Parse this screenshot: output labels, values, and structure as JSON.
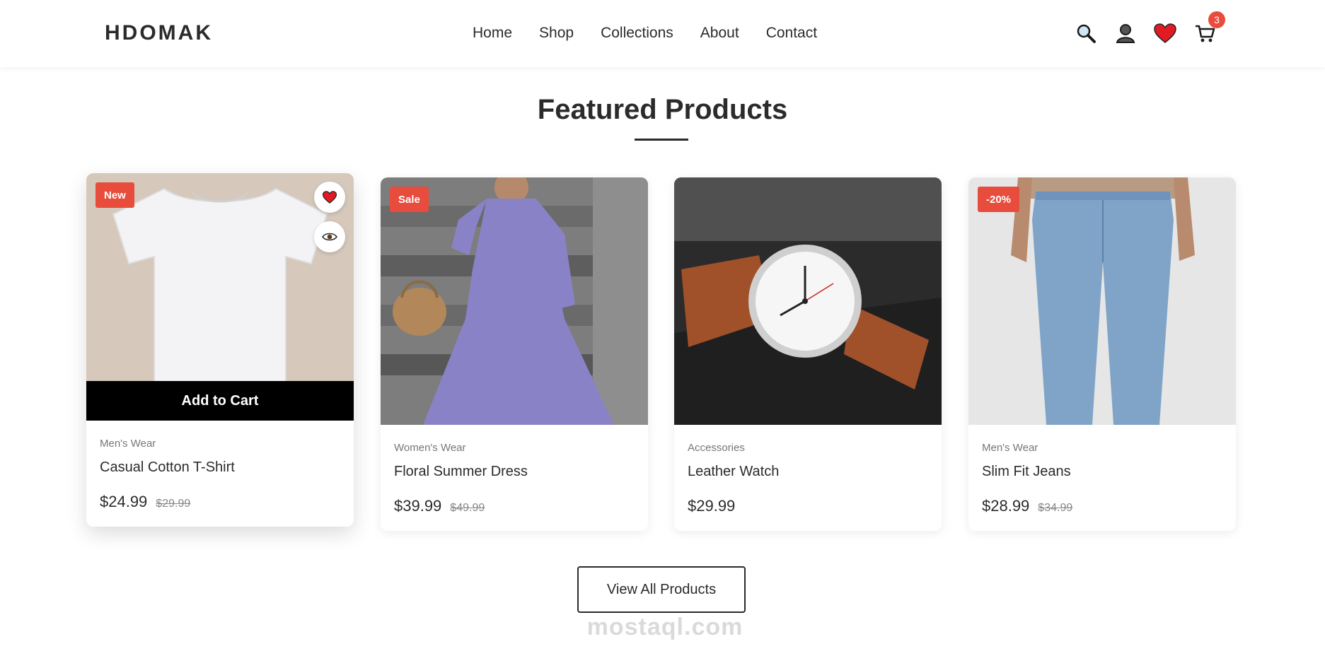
{
  "header": {
    "logo": "HDOMAK",
    "nav": [
      "Home",
      "Shop",
      "Collections",
      "About",
      "Contact"
    ],
    "icons": [
      "search-icon",
      "user-icon",
      "heart-icon",
      "cart-icon"
    ],
    "cart_count": "3"
  },
  "section": {
    "title": "Featured Products"
  },
  "products": [
    {
      "tag": "New",
      "category": "Men's Wear",
      "name": "Casual Cotton T-Shirt",
      "price": "$24.99",
      "old_price": "$29.99",
      "action": "Add to Cart"
    },
    {
      "tag": "Sale",
      "category": "Women's Wear",
      "name": "Floral Summer Dress",
      "price": "$39.99",
      "old_price": "$49.99"
    },
    {
      "tag": "",
      "category": "Accessories",
      "name": "Leather Watch",
      "price": "$29.99",
      "old_price": ""
    },
    {
      "tag": "-20%",
      "category": "Men's Wear",
      "name": "Slim Fit Jeans",
      "price": "$28.99",
      "old_price": "$34.99"
    }
  ],
  "view_all": "View All Products",
  "watermark": "mostaql.com",
  "colors": {
    "accent": "#e74c3c",
    "text": "#2b2b2b",
    "dark": "#000000"
  }
}
